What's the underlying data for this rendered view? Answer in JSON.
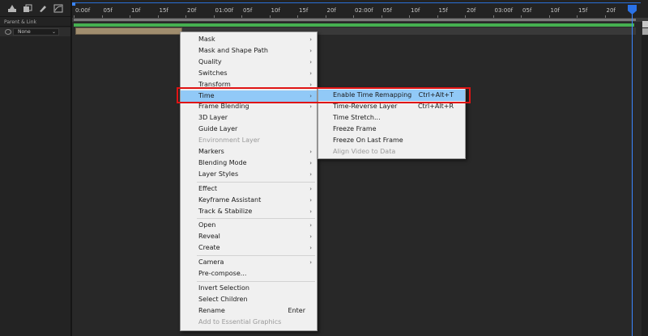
{
  "left_panel": {
    "parent_link_label": "Parent & Link",
    "parent_value": "None",
    "tool_icons": [
      "composition-flowchart-icon",
      "layers-icon",
      "paint-icon",
      "graph-editor-icon"
    ]
  },
  "ruler": {
    "ticks": [
      "0:00f",
      "05f",
      "10f",
      "15f",
      "20f",
      "01:00f",
      "05f",
      "10f",
      "15f",
      "20f",
      "02:00f",
      "05f",
      "10f",
      "15f",
      "20f",
      "03:00f",
      "05f",
      "10f",
      "15f",
      "20f"
    ]
  },
  "menu": {
    "groups": [
      [
        {
          "label": "Mask",
          "submenu": true
        },
        {
          "label": "Mask and Shape Path",
          "submenu": true
        },
        {
          "label": "Quality",
          "submenu": true
        },
        {
          "label": "Switches",
          "submenu": true
        },
        {
          "label": "Transform",
          "submenu": true
        },
        {
          "label": "Time",
          "submenu": true,
          "highlighted": true
        },
        {
          "label": "Frame Blending",
          "submenu": true
        },
        {
          "label": "3D Layer"
        },
        {
          "label": "Guide Layer"
        },
        {
          "label": "Environment Layer",
          "disabled": true
        },
        {
          "label": "Markers",
          "submenu": true
        },
        {
          "label": "Blending Mode",
          "submenu": true
        },
        {
          "label": "Layer Styles",
          "submenu": true
        }
      ],
      [
        {
          "label": "Effect",
          "submenu": true
        },
        {
          "label": "Keyframe Assistant",
          "submenu": true
        },
        {
          "label": "Track & Stabilize",
          "submenu": true
        }
      ],
      [
        {
          "label": "Open",
          "submenu": true
        },
        {
          "label": "Reveal",
          "submenu": true
        },
        {
          "label": "Create",
          "submenu": true
        }
      ],
      [
        {
          "label": "Camera",
          "submenu": true
        },
        {
          "label": "Pre-compose..."
        }
      ],
      [
        {
          "label": "Invert Selection"
        },
        {
          "label": "Select Children"
        },
        {
          "label": "Rename",
          "shortcut": "Enter"
        },
        {
          "label": "Add to Essential Graphics",
          "disabled": true
        }
      ]
    ],
    "time_submenu": [
      {
        "label": "Enable Time Remapping",
        "shortcut": "Ctrl+Alt+T",
        "highlighted": true
      },
      {
        "label": "Time-Reverse Layer",
        "shortcut": "Ctrl+Alt+R"
      },
      {
        "label": "Time Stretch..."
      },
      {
        "label": "Freeze Frame"
      },
      {
        "label": "Freeze On Last Frame"
      },
      {
        "label": "Align Video to Data",
        "disabled": true
      }
    ]
  },
  "colors": {
    "menu_highlight": "#91c9f7",
    "annotation_box": "#e01414",
    "playhead": "#2a72e8",
    "layer_bar_green": "#45b050"
  }
}
